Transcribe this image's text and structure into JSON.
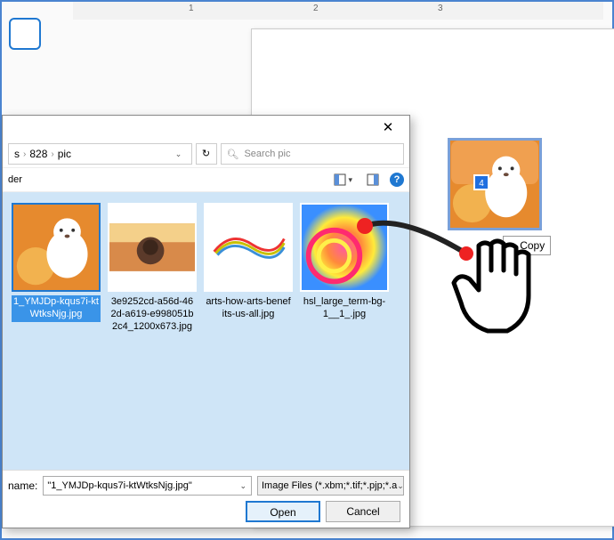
{
  "ruler": {
    "marks": [
      "1",
      "2",
      "3"
    ]
  },
  "drag": {
    "count": "4",
    "copy_label": "Copy"
  },
  "dialog": {
    "breadcrumb": {
      "items": [
        "s",
        "828",
        "pic"
      ]
    },
    "search": {
      "placeholder": "Search pic"
    },
    "toolbar": {
      "folder_label": "der"
    },
    "files": [
      {
        "name": "1_YMJDp-kqus7i-ktWtksNjg.jpg",
        "selected": true
      },
      {
        "name": "3e9252cd-a56d-462d-a619-e998051b2c4_1200x673.jpg",
        "selected": false
      },
      {
        "name": "arts-how-arts-benefits-us-all.jpg",
        "selected": false
      },
      {
        "name": "hsl_large_term-bg-1__1_.jpg",
        "selected": false
      }
    ],
    "filename_label": "name:",
    "filename_value": "\"1_YMJDp-kqus7i-ktWtksNjg.jpg\"",
    "type_filter": "Image Files (*.xbm;*.tif;*.pjp;*.a",
    "open_label": "Open",
    "cancel_label": "Cancel"
  }
}
